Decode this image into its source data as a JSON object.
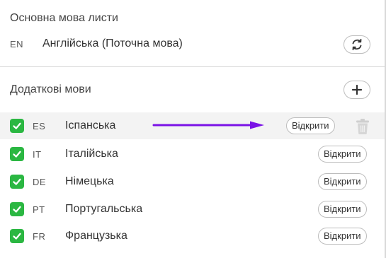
{
  "primary": {
    "title": "Основна мова листи",
    "code": "EN",
    "name": "Англійська (Поточна мова)",
    "switch_icon": "refresh-icon"
  },
  "additional": {
    "title": "Додаткові мови",
    "add_icon": "plus-icon",
    "open_label": "Відкрити",
    "languages": [
      {
        "code": "ES",
        "name": "Іспанська",
        "checked": true
      },
      {
        "code": "IT",
        "name": "Італійська",
        "checked": true
      },
      {
        "code": "DE",
        "name": "Німецька",
        "checked": true
      },
      {
        "code": "PT",
        "name": "Португальська",
        "checked": true
      },
      {
        "code": "FR",
        "name": "Французька",
        "checked": true
      }
    ]
  },
  "colors": {
    "check": "#2bb742",
    "annotation_arrow": "#7a12e6",
    "highlight_row": "#f3f3f3"
  }
}
